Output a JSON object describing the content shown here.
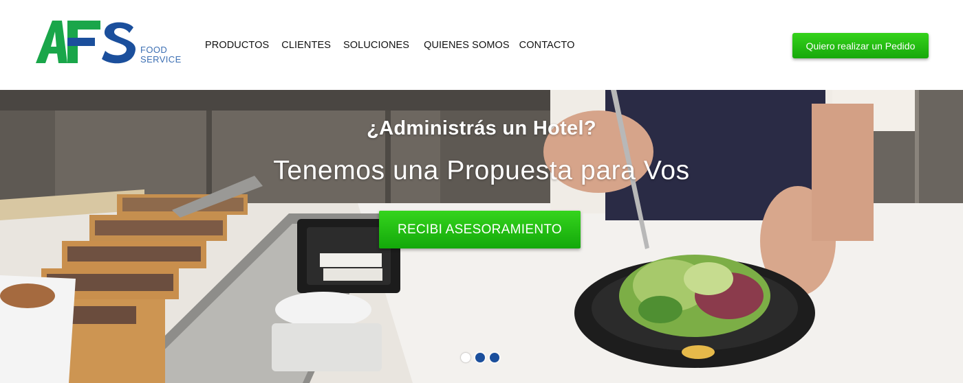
{
  "brand": {
    "logo_letters": "AFS",
    "logo_line1": "FOOD",
    "logo_line2": "SERVICE",
    "colors": {
      "green": "#1aa64a",
      "blue": "#1b4f9c",
      "tagline": "#3c6fb3"
    }
  },
  "nav": {
    "items": [
      {
        "label": "PRODUCTOS"
      },
      {
        "label": "CLIENTES"
      },
      {
        "label": "SOLUCIONES"
      },
      {
        "label": "QUIENES SOMOS"
      },
      {
        "label": "CONTACTO"
      }
    ],
    "order_button": "Quiero realizar un Pedido"
  },
  "hero": {
    "title": "¿Administrás un Hotel?",
    "subtitle": "Tenemos una Propuesta para Vos",
    "cta": "RECIBI ASESORAMIENTO",
    "carousel": {
      "total_slides": 3,
      "active_slide": 1
    },
    "accent_color": "#23bf13"
  }
}
